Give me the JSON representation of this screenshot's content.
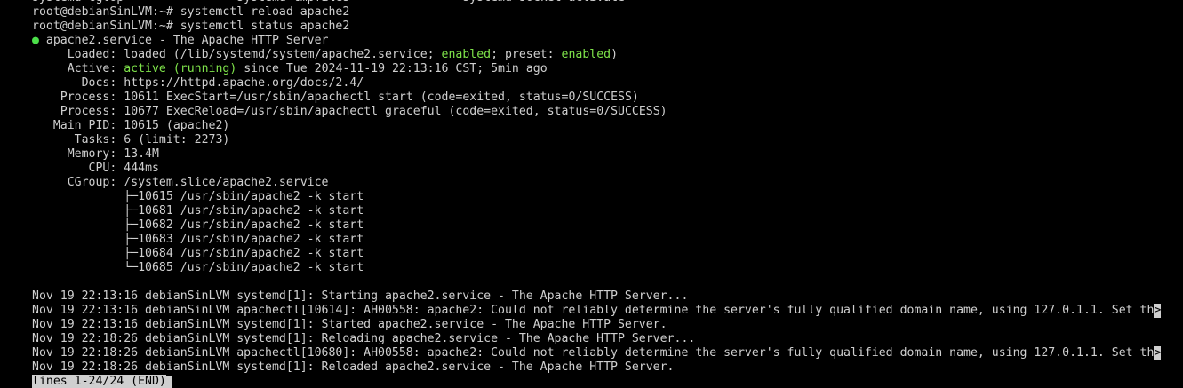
{
  "top_partial": {
    "left": "systemd-cgtop",
    "mid": "systemd-tmpfiles",
    "right": "systemd-socket-activate"
  },
  "prompt_lines": [
    "root@debianSinLVM:~# systemctl reload apache2",
    "root@debianSinLVM:~# systemctl status apache2"
  ],
  "service": {
    "bullet": "●",
    "header": "apache2.service - The Apache HTTP Server",
    "loaded_label": "Loaded:",
    "loaded_prefix": "loaded (/lib/systemd/system/apache2.service;",
    "loaded_enabled": "enabled",
    "loaded_middle": "; preset:",
    "loaded_preset": "enabled",
    "loaded_suffix": ")",
    "active_label": "Active:",
    "active_state": "active (running)",
    "active_since": "since Tue 2024-11-19 22:13:16 CST; 5min ago",
    "docs_label": "Docs:",
    "docs_value": "https://httpd.apache.org/docs/2.4/",
    "process_label": "Process:",
    "process_1": "10611 ExecStart=/usr/sbin/apachectl start (code=exited, status=0/SUCCESS)",
    "process_2": "10677 ExecReload=/usr/sbin/apachectl graceful (code=exited, status=0/SUCCESS)",
    "mainpid_label": "Main PID:",
    "mainpid_value": "10615 (apache2)",
    "tasks_label": "Tasks:",
    "tasks_value": "6 (limit: 2273)",
    "memory_label": "Memory:",
    "memory_value": "13.4M",
    "cpu_label": "CPU:",
    "cpu_value": "444ms",
    "cgroup_label": "CGroup:",
    "cgroup_value": "/system.slice/apache2.service",
    "cgroup_tree": [
      "├─10615 /usr/sbin/apache2 -k start",
      "├─10681 /usr/sbin/apache2 -k start",
      "├─10682 /usr/sbin/apache2 -k start",
      "├─10683 /usr/sbin/apache2 -k start",
      "├─10684 /usr/sbin/apache2 -k start",
      "└─10685 /usr/sbin/apache2 -k start"
    ]
  },
  "journal": [
    "Nov 19 22:13:16 debianSinLVM systemd[1]: Starting apache2.service - The Apache HTTP Server...",
    "Nov 19 22:13:16 debianSinLVM apachectl[10614]: AH00558: apache2: Could not reliably determine the server's fully qualified domain name, using 127.0.1.1. Set th",
    "Nov 19 22:13:16 debianSinLVM systemd[1]: Started apache2.service - The Apache HTTP Server.",
    "Nov 19 22:18:26 debianSinLVM systemd[1]: Reloading apache2.service - The Apache HTTP Server...",
    "Nov 19 22:18:26 debianSinLVM apachectl[10680]: AH00558: apache2: Could not reliably determine the server's fully qualified domain name, using 127.0.1.1. Set th",
    "Nov 19 22:18:26 debianSinLVM systemd[1]: Reloaded apache2.service - The Apache HTTP Server."
  ],
  "truncation_marker": ">",
  "pager_status": "lines 1-24/24 (END)",
  "colors": {
    "background": "#000000",
    "foreground": "#cfcfcf",
    "enabled_green": "#7ee24a",
    "bullet_green": "#4ce04a"
  }
}
